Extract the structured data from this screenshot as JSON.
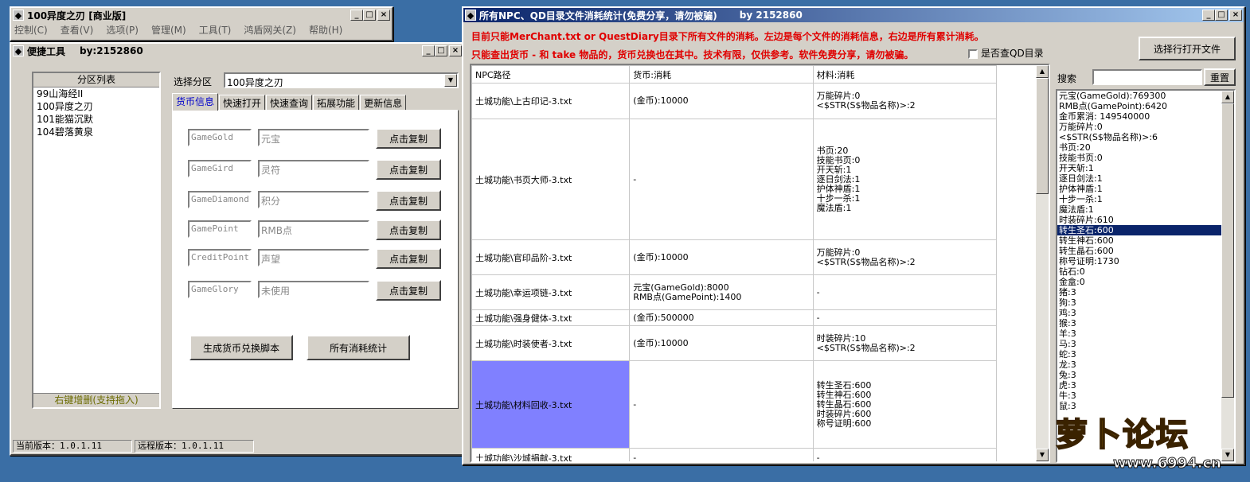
{
  "win1": {
    "title": "100异度之刃 [商业版]",
    "menu": [
      "控制(C)",
      "查看(V)",
      "选项(P)",
      "管理(M)",
      "工具(T)",
      "鸿盾网关(Z)",
      "帮助(H)"
    ]
  },
  "win2": {
    "title": "便捷工具",
    "by": "by:2152860",
    "list_header": "分区列表",
    "list_items": [
      "99山海经II",
      "100异度之刃",
      "101能猫沉默",
      "104碧落黄泉"
    ],
    "list_footer": "右键增删(支持拖入)",
    "select_label": "选择分区",
    "select_value": "100异度之刃",
    "tabs": [
      "货币信息",
      "快速打开",
      "快速查询",
      "拓展功能",
      "更新信息"
    ],
    "rows": [
      {
        "key": "GameGold",
        "name": "元宝",
        "btn": "点击复制"
      },
      {
        "key": "GameGird",
        "name": "灵符",
        "btn": "点击复制"
      },
      {
        "key": "GameDiamond",
        "name": "积分",
        "btn": "点击复制"
      },
      {
        "key": "GamePoint",
        "name": "RMB点",
        "btn": "点击复制"
      },
      {
        "key": "CreditPoint",
        "name": "声望",
        "btn": "点击复制"
      },
      {
        "key": "GameGlory",
        "name": "未使用",
        "btn": "点击复制"
      }
    ],
    "gen_btn": "生成货币兑换脚本",
    "stats_btn": "所有消耗统计",
    "status_local": "当前版本：1.0.1.11",
    "status_remote": "远程版本：1.0.1.11"
  },
  "win3": {
    "title": "所有NPC、QD目录文件消耗统计(免费分享，请勿被骗)",
    "by": "by 2152860",
    "note1": "目前只能MerChant.txt or QuestDiary目录下所有文件的消耗。左边是每个文件的消耗信息，右边是所有累计消耗。",
    "note2": "只能查出货币 - 和 take 物品的，货币兑换也在其中。技术有限，仅供参考。软件免费分享，请勿被骗。",
    "qd_check": "是否查QD目录",
    "open_btn": "选择行打开文件",
    "cols": [
      "NPC路径",
      "货币:消耗",
      "材料:消耗"
    ],
    "rows": [
      {
        "path": "土城功能\\上古印记-3.txt",
        "money": "(金币):10000",
        "mat": "万能碎片:0\n<$STR(S$物品名称)>:2"
      },
      {
        "path": "土城功能\\书页大师-3.txt",
        "money": "-",
        "mat": "书页:20\n技能书页:0\n开天斩:1\n逐日剑法:1\n护体神盾:1\n十步一杀:1\n魔法盾:1"
      },
      {
        "path": "土城功能\\官印品阶-3.txt",
        "money": "(金币):10000",
        "mat": "万能碎片:0\n<$STR(S$物品名称)>:2"
      },
      {
        "path": "土城功能\\幸运项链-3.txt",
        "money": "元宝(GameGold):8000\nRMB点(GamePoint):1400",
        "mat": "-"
      },
      {
        "path": "土城功能\\强身健体-3.txt",
        "money": "(金币):500000",
        "mat": "-"
      },
      {
        "path": "土城功能\\时装使者-3.txt",
        "money": "(金币):10000",
        "mat": "时装碎片:10\n<$STR(S$物品名称)>:2"
      },
      {
        "path": "土城功能\\材料回收-3.txt",
        "money": "-",
        "mat": "转生圣石:600\n转生神石:600\n转生晶石:600\n时装碎片:600\n称号证明:600"
      },
      {
        "path": "土城功能\\沙城捐献-3.txt",
        "money": "-",
        "mat": "-"
      }
    ],
    "search_label": "搜索",
    "reset_btn": "重置",
    "totals": [
      "元宝(GameGold):769300",
      "RMB点(GamePoint):6420",
      "金币累消: 149540000",
      "万能碎片:0",
      "<$STR(S$物品名称)>:6",
      "书页:20",
      "技能书页:0",
      "开天斩:1",
      "逐日剑法:1",
      "护体神盾:1",
      "十步一杀:1",
      "魔法盾:1",
      "时装碎片:610",
      "转生圣石:600",
      "转生神石:600",
      "转生晶石:600",
      "称号证明:1730",
      "钻石:0",
      "金盒:0",
      "猪:3",
      "狗:3",
      "鸡:3",
      "猴:3",
      "羊:3",
      "马:3",
      "蛇:3",
      "龙:3",
      "兔:3",
      "虎:3",
      "牛:3",
      "鼠:3"
    ],
    "selected_total": 13
  },
  "watermark": {
    "text": "萝卜论坛",
    "url": "www.6994.cn"
  }
}
